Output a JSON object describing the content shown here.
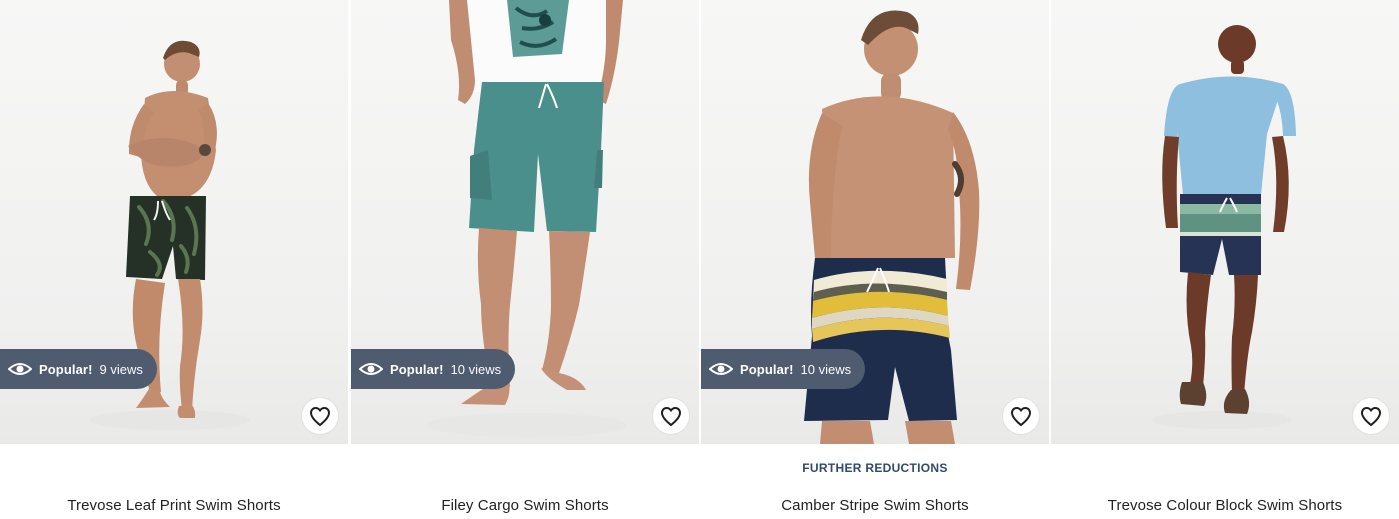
{
  "products": [
    {
      "title": "Trevose Leaf Print Swim Shorts",
      "promo": "",
      "badge": {
        "label": "Popular!",
        "views": "9 views"
      }
    },
    {
      "title": "Filey Cargo Swim Shorts",
      "promo": "",
      "badge": {
        "label": "Popular!",
        "views": "10 views"
      }
    },
    {
      "title": "Camber Stripe Swim Shorts",
      "promo": "FURTHER REDUCTIONS",
      "badge": {
        "label": "Popular!",
        "views": "10 views"
      }
    },
    {
      "title": "Trevose Colour Block Swim Shorts",
      "promo": "",
      "badge": null
    }
  ],
  "ui": {
    "eye_icon": "eye-icon",
    "heart_icon": "heart-outline-icon",
    "badge_bg": "#4f5b6f",
    "promo_color": "#2f4a6b"
  }
}
